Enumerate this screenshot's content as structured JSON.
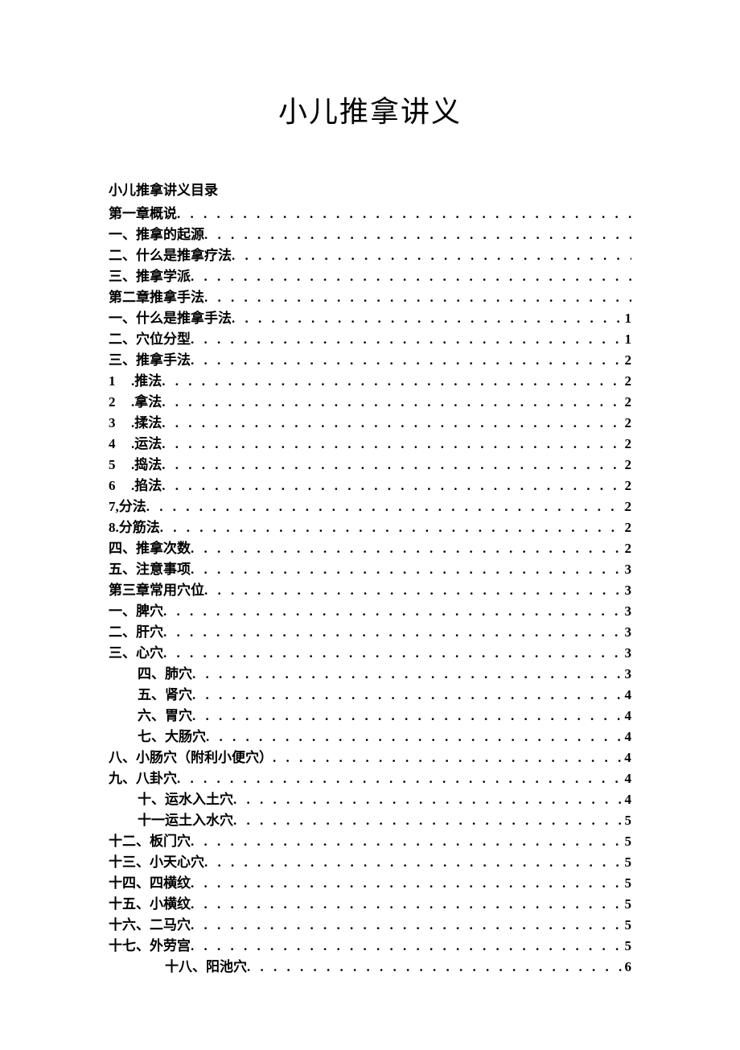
{
  "title": "小儿推拿讲义",
  "toc_heading": "小儿推拿讲义目录",
  "entries": [
    {
      "label": "第一章概说",
      "dots": " . . . . . . . . . . . . . . . . . . . . . . . . . . . . . . . . . . . . . . . .",
      "page": "",
      "indent": 0,
      "numbered": false
    },
    {
      "label": "一、推拿的起源",
      "dots": " . . . . . . . . . . . . . . . . . . . . . . . . . . . . . . . . . . . .",
      "page": "",
      "indent": 0,
      "numbered": false
    },
    {
      "label": "二、什么是推拿疗法",
      "dots": " . . . . . . . . . . . . . . . . . . . . . . . . . . . . . . . .",
      "page": "",
      "indent": 0,
      "numbered": false
    },
    {
      "label": "三、推拿学派",
      "dots": " . . . . . . . . . . . . . . . . . . . . . . . . . . . . . . . . . . . . . . .",
      "page": "",
      "indent": 0,
      "numbered": false
    },
    {
      "label": "第二章推拿手法",
      "dots": " . . . . . . . . . . . . . . . . . . . . . . . . . . . . . . . . . . . .",
      "page": "",
      "indent": 0,
      "numbered": false
    },
    {
      "label": "一、什么是推拿手法",
      "dots": " . . . . . . . . . . . . . . . . . . . . . . . . . . . . . . . .",
      "page": "1",
      "indent": 0,
      "numbered": false
    },
    {
      "label": "二、穴位分型",
      "dots": " . . . . . . . . . . . . . . . . . . . . . . . . . . . . . . . . . . . . . . .",
      "page": "1",
      "indent": 0,
      "numbered": false
    },
    {
      "label": "三、推拿手法",
      "dots": " . . . . . . . . . . . . . . . . . . . . . . . . . . . . . . . . . . . . . . . .",
      "page": "2",
      "indent": 0,
      "numbered": false
    },
    {
      "num": "1",
      "label": ".推法",
      "dots": " . . . . . . . . . . . . . . . . . . . . . . . . . . . . . . . . . . . . .",
      "page": "2",
      "indent": 0,
      "numbered": true
    },
    {
      "num": "2",
      "label": ".拿法",
      "dots": " . . . . . . . . . . . . . . . . . . . . . . . . . . . . . . . . . . . . . . . . .",
      "page": "2",
      "indent": 0,
      "numbered": true
    },
    {
      "num": "3",
      "label": ".揉法",
      "dots": " . . . . . . . . . . . . . . . . . . . . . . . . . . . . . . . . . . . . . . . .",
      "page": "2",
      "indent": 0,
      "numbered": true
    },
    {
      "num": "4",
      "label": ".运法",
      "dots": " . . . . . . . . . . . . . . . . . . . . . . . . . . . . . . . . . . . . . . . . .",
      "page": "2",
      "indent": 0,
      "numbered": true
    },
    {
      "num": "5",
      "label": ".捣法",
      "dots": " . . . . . . . . . . . . . . . . . . . . . . . . . . . . . . . . . . . . .",
      "page": "2",
      "indent": 0,
      "numbered": true
    },
    {
      "num": "6",
      "label": ".掐法",
      "dots": " . . . . . . . . . . . . . . . . . . . . . . . . . . . . . . . . . . . . . . . .",
      "page": "2",
      "indent": 0,
      "numbered": true
    },
    {
      "label": "7,分法",
      "dots": ". . . . . . . . . . . . . . . . . . . . . . . . . . . . . . . . . . . . . . . . . .",
      "page": "2",
      "indent": 0,
      "numbered": false
    },
    {
      "label": "8.分筋法",
      "dots": ". . . . . . . . . . . . . . . . . . . . . . . . . . . . . . . . . . . . . . . .",
      "page": "2",
      "indent": 0,
      "numbered": false
    },
    {
      "label": "四、推拿次数",
      "dots": " . . . . . . . . . . . . . . . . . . . . . . . . . . . . . . . . . . . . . . . .",
      "page": "2",
      "indent": 0,
      "numbered": false
    },
    {
      "label": "五、注意事项",
      "dots": " . . . . . . . . . . . . . . . . . . . . . . . . . . . . . . . . . . . . . . . .",
      "page": "3",
      "indent": 0,
      "numbered": false
    },
    {
      "label": "第三章常用穴位",
      "dots": " . . . . . . . . . . . . . . . . . . . . . . . . . . . . . . . . . . . . .",
      "page": "3",
      "indent": 0,
      "numbered": false
    },
    {
      "label": "一、脾穴",
      "dots": " . . . . . . . . . . . . . . . . . . . . . . . . . . . . . . . . . . . . . . . . . . . .",
      "page": "3",
      "indent": 0,
      "numbered": false
    },
    {
      "label": "二、肝穴",
      "dots": " . . . . . . . . . . . . . . . . . . . . . . . . . . . . . . . . . . . . . . . . . . . .",
      "page": "3",
      "indent": 0,
      "numbered": false
    },
    {
      "label": "三、心穴",
      "dots": " . . . . . . . . . . . . . . . . . . . . . . . . . . . . . . . . . . . . . . . . . . . .",
      "page": "3",
      "indent": 0,
      "numbered": false
    },
    {
      "label": "四、肺穴",
      "dots": " . . . . . . . . . . . . . . . . . . . . . . . . . . . . . . . . . . . . . . . . . . .",
      "page": "3",
      "indent": 1,
      "numbered": false
    },
    {
      "label": "五、肾穴",
      "dots": " . . . . . . . . . . . . . . . . . . . . . . . . . . . . . . . . . . . . . . . . . . .",
      "page": "4",
      "indent": 1,
      "numbered": false
    },
    {
      "label": "六、胃穴",
      "dots": " . . . . . . . . . . . . . . . . . . . . . . . . . . . . . . . . . . . . . . . . . . .",
      "page": "4",
      "indent": 1,
      "numbered": false
    },
    {
      "label": "七、大肠穴",
      "dots": " . . . . . . . . . . . . . . . . . . . . . . . . . . . . . . . . . . . . . . . .",
      "page": "4",
      "indent": 1,
      "numbered": false
    },
    {
      "label": "八、小肠穴（附利小便穴）",
      "dots": " . . . . . . . . . . . . . . . . . . . . . . . . . . .",
      "page": "4",
      "indent": 0,
      "numbered": false
    },
    {
      "label": "九、八卦穴",
      "dots": ". . . . . . . . . . . . . . . . . . . . . . . . . . . . . . . . . . . . . . . . . .",
      "page": "4",
      "indent": 0,
      "numbered": false
    },
    {
      "label": "十、运水入土穴",
      "dots": ". . . . . . . . . . . . . . . . . . . . . . . . . . . . . . . . . . . . .",
      "page": "4",
      "indent": 1,
      "numbered": false
    },
    {
      "label": "十一运土入水穴",
      "dots": ". . . . . . . . . . . . . . . . . . . . . . . . . . . . . . . . . . . .",
      "page": "5",
      "indent": 1,
      "numbered": false
    },
    {
      "label": "十二、板门穴",
      "dots": " . . . . . . . . . . . . . . . . . . . . . . . . . . . . . . . . . . . . . . . .",
      "page": "5",
      "indent": 0,
      "numbered": false
    },
    {
      "label": "十三、小天心穴",
      "dots": " . . . . . . . . . . . . . . . . . . . . . . . . . . . . . . . . . . . . .",
      "page": "5",
      "indent": 0,
      "numbered": false
    },
    {
      "label": "十四、四横纹",
      "dots": " . . . . . . . . . . . . . . . . . . . . . . . . . . . . . . . . . . . . . . .",
      "page": "5",
      "indent": 0,
      "numbered": false
    },
    {
      "label": "十五、小横纹",
      "dots": " . . . . . . . . . . . . . . . . . . . . . . . . . . . . . . . . . . . . . . .",
      "page": "5",
      "indent": 0,
      "numbered": false
    },
    {
      "label": "十六、二马穴",
      "dots": " . . . . . . . . . . . . . . . . . . . . . . . . . . . . . . . . . . . . . . .",
      "page": "5",
      "indent": 0,
      "numbered": false
    },
    {
      "label": "十七、外劳宫",
      "dots": " . . . . . . . . . . . . . . . . . . . . . . . . . . . . . . . . . . . . . . .",
      "page": "5",
      "indent": 0,
      "numbered": false
    },
    {
      "label": "十八、阳池穴",
      "dots": ". . . . . . . . . . . . . . . . . . . . . . . . . . . . . . . . . . . . . . .",
      "page": "6",
      "indent": 2,
      "numbered": false
    }
  ]
}
